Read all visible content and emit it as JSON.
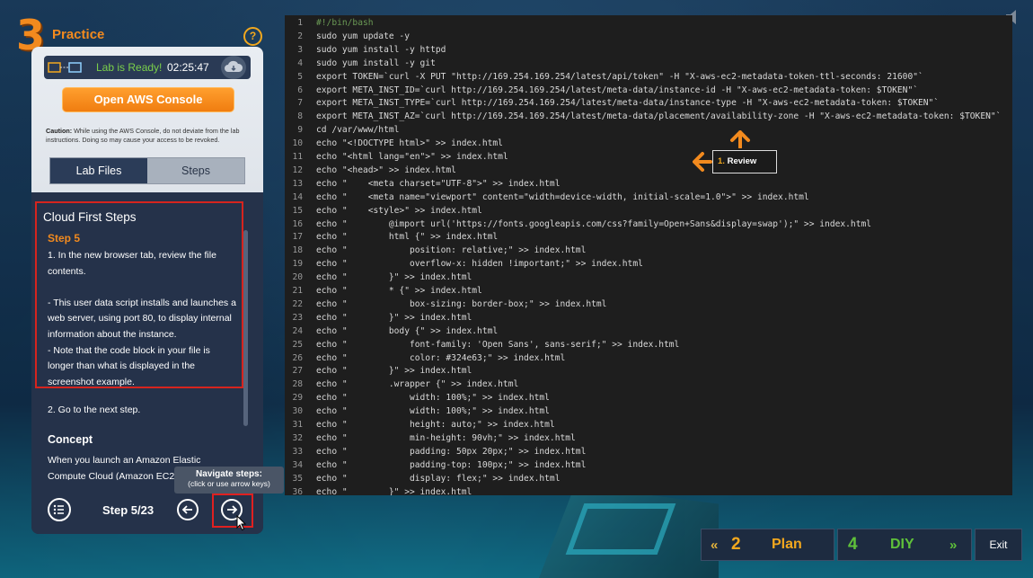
{
  "header": {
    "phase_number": "3",
    "phase_title": "Practice",
    "help_label": "?"
  },
  "status": {
    "ready_text": "Lab is Ready!",
    "timer": "02:25:47"
  },
  "console_button": "Open AWS Console",
  "caution": {
    "label": "Caution:",
    "text": " While using the AWS Console, do not deviate from the lab instructions. Doing so may cause your access to be revoked."
  },
  "tabs": {
    "lab_files": "Lab Files",
    "steps": "Steps",
    "active": "Steps"
  },
  "content": {
    "heading": "Cloud First Steps",
    "step_label": "Step 5",
    "step_lines": [
      "1. In the new browser tab, review the file",
      "contents.",
      "",
      "- This user data script installs and launches a",
      "web server, using port 80, to display internal",
      "information about the instance.",
      "- Note that the code block in your file is",
      "longer than what is displayed in the",
      "screenshot example."
    ],
    "next_step": "2. Go to the next step.",
    "concept_heading": "Concept",
    "concept_lines": [
      "When you launch an Amazon Elastic",
      "Compute Cloud (Amazon EC2)"
    ]
  },
  "footer": {
    "step_counter": "Step 5/23",
    "tooltip_title": "Navigate steps:",
    "tooltip_sub": "(click or use arrow keys)"
  },
  "review": {
    "number": "1.",
    "label": "Review"
  },
  "code": {
    "lines": [
      {
        "n": "1",
        "t": "#!/bin/bash"
      },
      {
        "n": "2",
        "t": "sudo yum update -y"
      },
      {
        "n": "3",
        "t": "sudo yum install -y httpd"
      },
      {
        "n": "4",
        "t": "sudo yum install -y git"
      },
      {
        "n": "5",
        "t": "export TOKEN=`curl -X PUT \"http://169.254.169.254/latest/api/token\" -H \"X-aws-ec2-metadata-token-ttl-seconds: 21600\"`"
      },
      {
        "n": "6",
        "t": "export META_INST_ID=`curl http://169.254.169.254/latest/meta-data/instance-id -H \"X-aws-ec2-metadata-token: $TOKEN\"`"
      },
      {
        "n": "7",
        "t": "export META_INST_TYPE=`curl http://169.254.169.254/latest/meta-data/instance-type -H \"X-aws-ec2-metadata-token: $TOKEN\"`"
      },
      {
        "n": "8",
        "t": "export META_INST_AZ=`curl http://169.254.169.254/latest/meta-data/placement/availability-zone -H \"X-aws-ec2-metadata-token: $TOKEN\"`"
      },
      {
        "n": "9",
        "t": "cd /var/www/html"
      },
      {
        "n": "10",
        "t": "echo \"<!DOCTYPE html>\" >> index.html"
      },
      {
        "n": "11",
        "t": "echo \"<html lang=\"en\">\" >> index.html"
      },
      {
        "n": "12",
        "t": "echo \"<head>\" >> index.html"
      },
      {
        "n": "13",
        "t": "echo \"    <meta charset=\"UTF-8\">\" >> index.html"
      },
      {
        "n": "14",
        "t": "echo \"    <meta name=\"viewport\" content=\"width=device-width, initial-scale=1.0\">\" >> index.html"
      },
      {
        "n": "15",
        "t": "echo \"    <style>\" >> index.html"
      },
      {
        "n": "16",
        "t": "echo \"        @import url('https://fonts.googleapis.com/css?family=Open+Sans&display=swap');\" >> index.html"
      },
      {
        "n": "17",
        "t": "echo \"        html {\" >> index.html"
      },
      {
        "n": "18",
        "t": "echo \"            position: relative;\" >> index.html"
      },
      {
        "n": "19",
        "t": "echo \"            overflow-x: hidden !important;\" >> index.html"
      },
      {
        "n": "20",
        "t": "echo \"        }\" >> index.html"
      },
      {
        "n": "21",
        "t": "echo \"        * {\" >> index.html"
      },
      {
        "n": "22",
        "t": "echo \"            box-sizing: border-box;\" >> index.html"
      },
      {
        "n": "23",
        "t": "echo \"        }\" >> index.html"
      },
      {
        "n": "24",
        "t": "echo \"        body {\" >> index.html"
      },
      {
        "n": "25",
        "t": "echo \"            font-family: 'Open Sans', sans-serif;\" >> index.html"
      },
      {
        "n": "26",
        "t": "echo \"            color: #324e63;\" >> index.html"
      },
      {
        "n": "27",
        "t": "echo \"        }\" >> index.html"
      },
      {
        "n": "28",
        "t": "echo \"        .wrapper {\" >> index.html"
      },
      {
        "n": "29",
        "t": "echo \"            width: 100%;\" >> index.html"
      },
      {
        "n": "30",
        "t": "echo \"            width: 100%;\" >> index.html"
      },
      {
        "n": "31",
        "t": "echo \"            height: auto;\" >> index.html"
      },
      {
        "n": "32",
        "t": "echo \"            min-height: 90vh;\" >> index.html"
      },
      {
        "n": "33",
        "t": "echo \"            padding: 50px 20px;\" >> index.html"
      },
      {
        "n": "34",
        "t": "echo \"            padding-top: 100px;\" >> index.html"
      },
      {
        "n": "35",
        "t": "echo \"            display: flex;\" >> index.html"
      },
      {
        "n": "36",
        "t": "echo \"        }\" >> index.html"
      }
    ]
  },
  "bottom_nav": {
    "plan_chevrons": "«",
    "plan_number": "2",
    "plan_label": "Plan",
    "diy_number": "4",
    "diy_label": "DIY",
    "diy_chevrons": "»",
    "exit_label": "Exit"
  },
  "colors": {
    "accent_orange": "#f28a1e",
    "ready_green": "#7bd04a",
    "highlight_red": "#d6241e",
    "nav_green": "#5fc13a",
    "code_bg": "#1e1e1e"
  }
}
